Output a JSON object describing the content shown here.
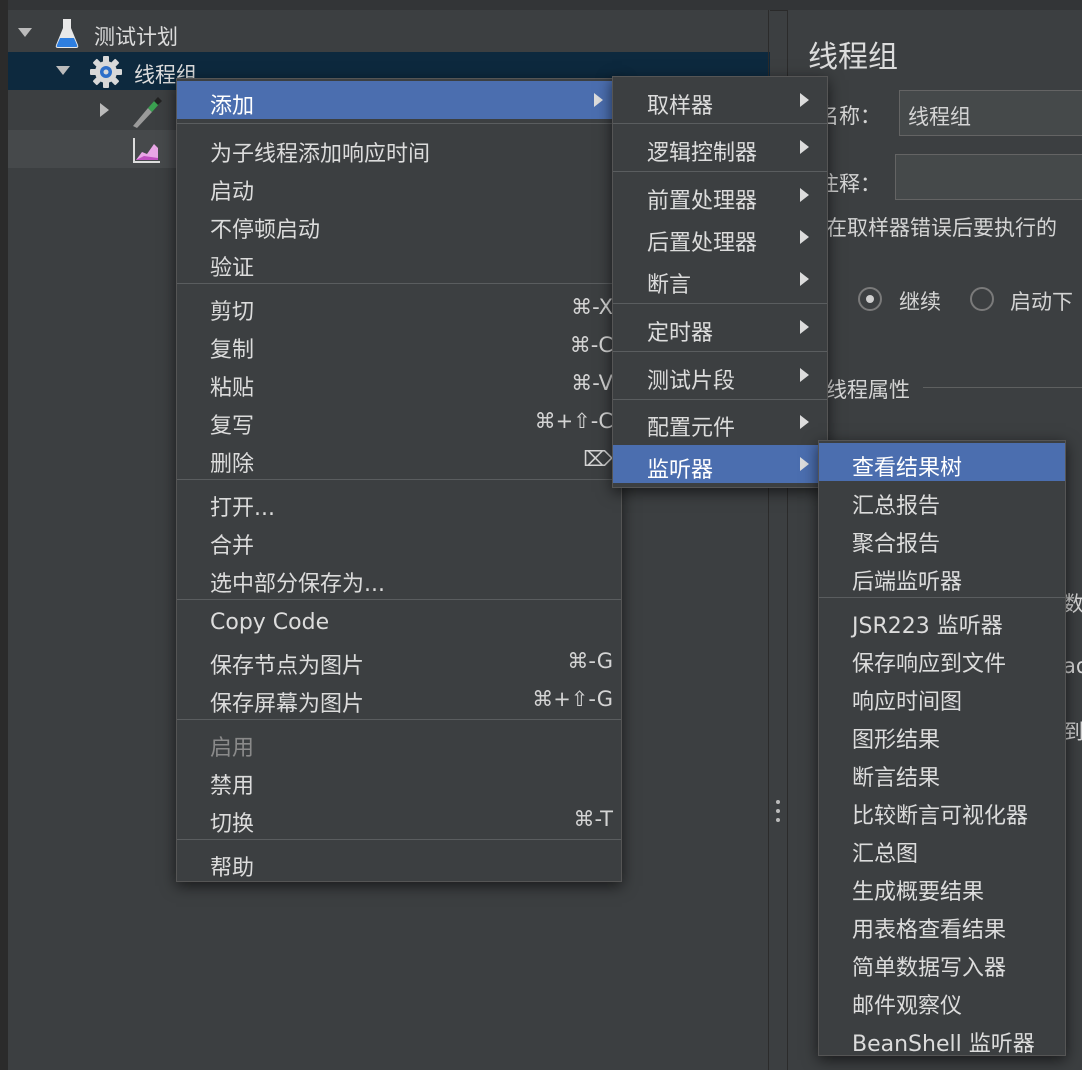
{
  "tree": {
    "root_label": "测试计划",
    "thread_group_label": "线程组"
  },
  "context_menu": [
    {
      "label": "添加",
      "shortcut": "",
      "submenu": true,
      "selected": true,
      "disabled": false
    },
    {
      "label": "为子线程添加响应时间",
      "shortcut": "",
      "submenu": false,
      "selected": false,
      "disabled": false
    },
    {
      "label": "启动",
      "shortcut": "",
      "submenu": false,
      "selected": false,
      "disabled": false
    },
    {
      "label": "不停顿启动",
      "shortcut": "",
      "submenu": false,
      "selected": false,
      "disabled": false
    },
    {
      "label": "验证",
      "shortcut": "",
      "submenu": false,
      "selected": false,
      "disabled": false
    },
    {
      "label": "剪切",
      "shortcut": "⌘-X",
      "submenu": false,
      "selected": false,
      "disabled": false
    },
    {
      "label": "复制",
      "shortcut": "⌘-C",
      "submenu": false,
      "selected": false,
      "disabled": false
    },
    {
      "label": "粘贴",
      "shortcut": "⌘-V",
      "submenu": false,
      "selected": false,
      "disabled": false
    },
    {
      "label": "复写",
      "shortcut": "⌘+⇧-C",
      "submenu": false,
      "selected": false,
      "disabled": false
    },
    {
      "label": "删除",
      "shortcut": "⌦",
      "submenu": false,
      "selected": false,
      "disabled": false
    },
    {
      "label": "打开...",
      "shortcut": "",
      "submenu": false,
      "selected": false,
      "disabled": false
    },
    {
      "label": "合并",
      "shortcut": "",
      "submenu": false,
      "selected": false,
      "disabled": false
    },
    {
      "label": "选中部分保存为...",
      "shortcut": "",
      "submenu": false,
      "selected": false,
      "disabled": false
    },
    {
      "label": "Copy Code",
      "shortcut": "",
      "submenu": false,
      "selected": false,
      "disabled": false
    },
    {
      "label": "保存节点为图片",
      "shortcut": "⌘-G",
      "submenu": false,
      "selected": false,
      "disabled": false
    },
    {
      "label": "保存屏幕为图片",
      "shortcut": "⌘+⇧-G",
      "submenu": false,
      "selected": false,
      "disabled": false
    },
    {
      "label": "启用",
      "shortcut": "",
      "submenu": false,
      "selected": false,
      "disabled": true
    },
    {
      "label": "禁用",
      "shortcut": "",
      "submenu": false,
      "selected": false,
      "disabled": false
    },
    {
      "label": "切换",
      "shortcut": "⌘-T",
      "submenu": false,
      "selected": false,
      "disabled": false
    },
    {
      "label": "帮助",
      "shortcut": "",
      "submenu": false,
      "selected": false,
      "disabled": false
    }
  ],
  "add_submenu": [
    {
      "label": "取样器",
      "selected": false
    },
    {
      "label": "逻辑控制器",
      "selected": false
    },
    {
      "label": "前置处理器",
      "selected": false
    },
    {
      "label": "后置处理器",
      "selected": false
    },
    {
      "label": "断言",
      "selected": false
    },
    {
      "label": "定时器",
      "selected": false
    },
    {
      "label": "测试片段",
      "selected": false
    },
    {
      "label": "配置元件",
      "selected": false
    },
    {
      "label": "监听器",
      "selected": true
    }
  ],
  "listener_submenu": [
    {
      "label": "查看结果树",
      "selected": true
    },
    {
      "label": "汇总报告",
      "selected": false
    },
    {
      "label": "聚合报告",
      "selected": false
    },
    {
      "label": "后端监听器",
      "selected": false
    },
    {
      "label": "JSR223 监听器",
      "selected": false
    },
    {
      "label": "保存响应到文件",
      "selected": false
    },
    {
      "label": "响应时间图",
      "selected": false
    },
    {
      "label": "图形结果",
      "selected": false
    },
    {
      "label": "断言结果",
      "selected": false
    },
    {
      "label": "比较断言可视化器",
      "selected": false
    },
    {
      "label": "汇总图",
      "selected": false
    },
    {
      "label": "生成概要结果",
      "selected": false
    },
    {
      "label": "用表格查看结果",
      "selected": false
    },
    {
      "label": "简单数据写入器",
      "selected": false
    },
    {
      "label": "邮件观察仪",
      "selected": false
    },
    {
      "label": "BeanShell 监听器",
      "selected": false
    }
  ],
  "right_panel": {
    "title": "线程组",
    "name_label": "名称：",
    "name_value": "线程组",
    "comment_label": "注释：",
    "sampler_error_text": "在取样器错误后要执行的",
    "radio_continue": "继续",
    "radio_start_next": "启动下",
    "thread_properties": "线程属性",
    "clip_1": "数达",
    "clip_2": "ad",
    "clip_3": "到"
  }
}
